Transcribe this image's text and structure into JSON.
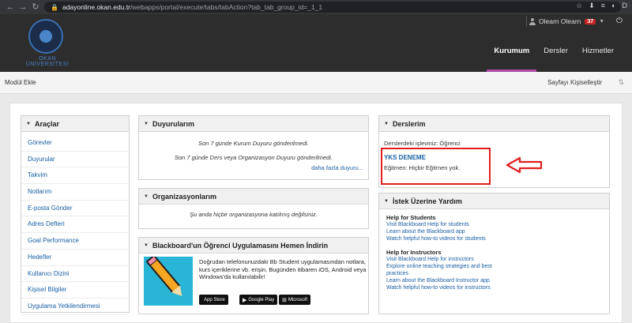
{
  "browser": {
    "back_icon": "←",
    "forward_icon": "→",
    "reload_icon": "↻",
    "home_icon": "⌂",
    "lock_icon": "🔒",
    "url_host": "adayonline.okan.edu.tr",
    "url_path": "/webapps/portal/execute/tabs/tabAction?tab_tab_group_id=_1_1",
    "toolbar_icons": [
      "☆",
      "⬇",
      "≡",
      "◐",
      "D"
    ]
  },
  "header": {
    "logo_text": "OKAN ÜNİVERSİTESİ",
    "user_name": "Olearn Olearn",
    "notification_count": "37",
    "tabs": [
      {
        "label": "Kurumum",
        "active": true
      },
      {
        "label": "Dersler",
        "active": false
      },
      {
        "label": "Hizmetler",
        "active": false
      }
    ],
    "accent_color": "#b04aa8"
  },
  "toolbar": {
    "add_module": "Modül Ekle",
    "personalize": "Sayfayı Kişiselleştir",
    "reorder_icon": "⇅"
  },
  "tools": {
    "title": "Araçlar",
    "items": [
      "Görevler",
      "Duyurular",
      "Takvim",
      "Notlarım",
      "E-posta Gönder",
      "Adres Defteri",
      "Goal Performance",
      "Hedefler",
      "Kullanıcı Dizini",
      "Kişisel Bilgiler",
      "Uygulama Yetkilendirmesi"
    ]
  },
  "announcements": {
    "title": "Duyurularım",
    "line1": "Son 7 günde Kurum Duyuru gönderilmedi.",
    "line2": "Son 7 günde Ders veya Organizasyon Duyuru gönderilmedi.",
    "more": "daha fazla duyuru..."
  },
  "organizations": {
    "title": "Organizasyonlarım",
    "empty": "Şu anda hiçbir organizasyona katılmış değilsiniz."
  },
  "mobile_app": {
    "title": "Blackboard'un Öğrenci Uygulamasını Hemen İndirin",
    "text": "Doğrudan telefonunuzdaki Bb Student uygulamasından notlara, kurs içeriklerine vb. erişin. Bugünden itibaren iOS, Android veya Windows'da kullanılabilir!",
    "stores": [
      {
        "glyph": "",
        "label": "App Store"
      },
      {
        "glyph": "▶",
        "label": "Google Play"
      },
      {
        "glyph": "⊞",
        "label": "Microsoft"
      }
    ]
  },
  "courses": {
    "title": "Derslerim",
    "role_line": "Derslerdeki işleviniz: Öğrenci",
    "course_name": "YKS DENEME",
    "teacher_line": "Eğitmen: Hiçbir Eğitmen yok.",
    "highlight_color": "#e01e1e"
  },
  "help": {
    "title": "İstek Üzerine Yardım",
    "students_title": "Help for Students",
    "students_links": [
      "Visit Blackboard Help for students",
      "Learn about the Blackboard app",
      "Watch helpful how-to videos for students"
    ],
    "instructors_title": "Help for Instructors",
    "instructors_links": [
      "Visit Blackboard Help for instructors",
      "Explore online teaching strategies and best practices",
      "Learn about the Blackboard Instructor app",
      "Watch helpful how-to videos for instructors"
    ]
  }
}
